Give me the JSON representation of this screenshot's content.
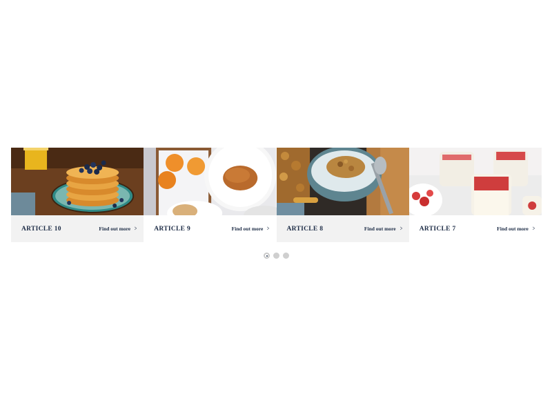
{
  "carousel": {
    "cards": [
      {
        "title": "ARTICLE 10",
        "link": "Find out more",
        "image": "pancakes-image"
      },
      {
        "title": "ARTICLE 9",
        "link": "Find out more",
        "image": "croissant-breakfast-image"
      },
      {
        "title": "ARTICLE 8",
        "link": "Find out more",
        "image": "granola-yogurt-bowl-image"
      },
      {
        "title": "ARTICLE 7",
        "link": "Find out more",
        "image": "strawberry-panna-cotta-image"
      }
    ],
    "pagination": {
      "pages": 3,
      "active_page": 1
    },
    "colors": {
      "title": "#1c2b45",
      "card_footer": "#f2f2f2",
      "dot": "#cfcfcf"
    }
  }
}
